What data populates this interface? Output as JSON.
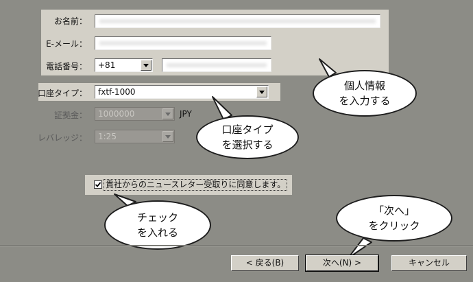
{
  "personal": {
    "name_label": "お名前：",
    "email_label": "E-メール：",
    "phone_label": "電話番号：",
    "country_code": "+81"
  },
  "account": {
    "type_label": "口座タイプ：",
    "type_value": "fxtf-1000",
    "deposit_label": "証拠金：",
    "deposit_value": "1000000",
    "currency": "JPY",
    "leverage_label": "レバレッジ：",
    "leverage_value": "1:25"
  },
  "newsletter": {
    "label": "貴社からのニュースレター受取りに同意します。",
    "checked": true
  },
  "bubbles": {
    "personal": "個人情報\nを入力する",
    "account_type": "口座タイプ\nを選択する",
    "check": "チェック\nを入れる",
    "next": "「次へ」\nをクリック"
  },
  "buttons": {
    "back": "< 戻る(B)",
    "next": "次へ(N) >",
    "cancel": "キャンセル"
  },
  "colors": {
    "background": "#8c8c86",
    "panel": "#d3d0c7",
    "bubble_fill": "#ffffff"
  }
}
